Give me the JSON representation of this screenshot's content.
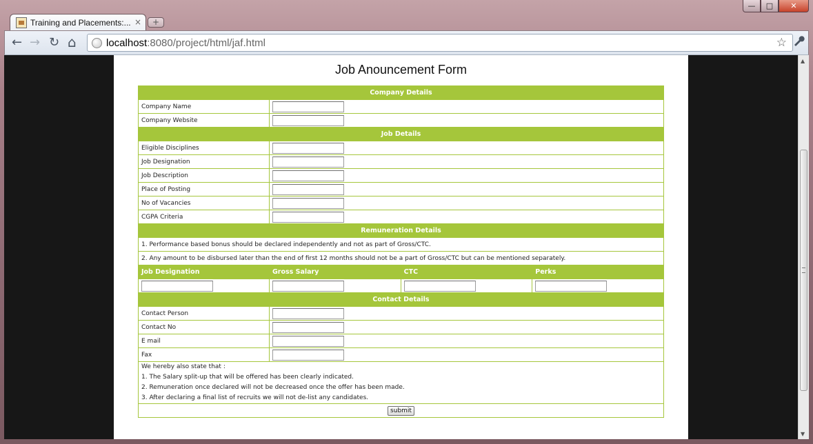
{
  "window": {
    "tab_title": "Training and Placements:...",
    "tab_close": "×",
    "new_tab": "+",
    "controls": {
      "minimize": "—",
      "maximize": "□",
      "close": "✕"
    }
  },
  "toolbar": {
    "back": "←",
    "forward": "→",
    "reload": "↻",
    "home": "⌂",
    "url_host": "localhost",
    "url_rest": ":8080/project/html/jaf.html",
    "star": "☆",
    "wrench": "🔧"
  },
  "scrollbar": {
    "up": "▲",
    "down": "▼"
  },
  "form": {
    "title": "Job Anouncement Form",
    "company_header": "Company Details",
    "company_fields": [
      "Company Name",
      "Company Website"
    ],
    "job_header": "Job Details",
    "job_fields": [
      "Eligible Disciplines",
      "Job Designation",
      "Job Description",
      "Place of Posting",
      "No of Vacancies",
      "CGPA Criteria"
    ],
    "remuneration_header": "Remuneration Details",
    "remuneration_notes": [
      "1. Performance based bonus should be declared independently and not as part of Gross/CTC.",
      "2. Any amount to be disbursed later than the end of first 12 months should not be a part of Gross/CTC but can be mentioned separately."
    ],
    "remuneration_columns": [
      "Job Designation",
      "Gross Salary",
      "CTC",
      "Perks"
    ],
    "contact_header": "Contact Details",
    "contact_fields": [
      "Contact Person",
      "Contact No",
      "E mail",
      "Fax"
    ],
    "declaration": [
      "We hereby also state that :",
      "1. The Salary split-up that will be offered has been clearly indicated.",
      "2. Remuneration once declared will not be decreased once the offer has been made.",
      "3. After declaring a final list of recruits we will not de-list any candidates."
    ],
    "submit_label": "submit"
  }
}
